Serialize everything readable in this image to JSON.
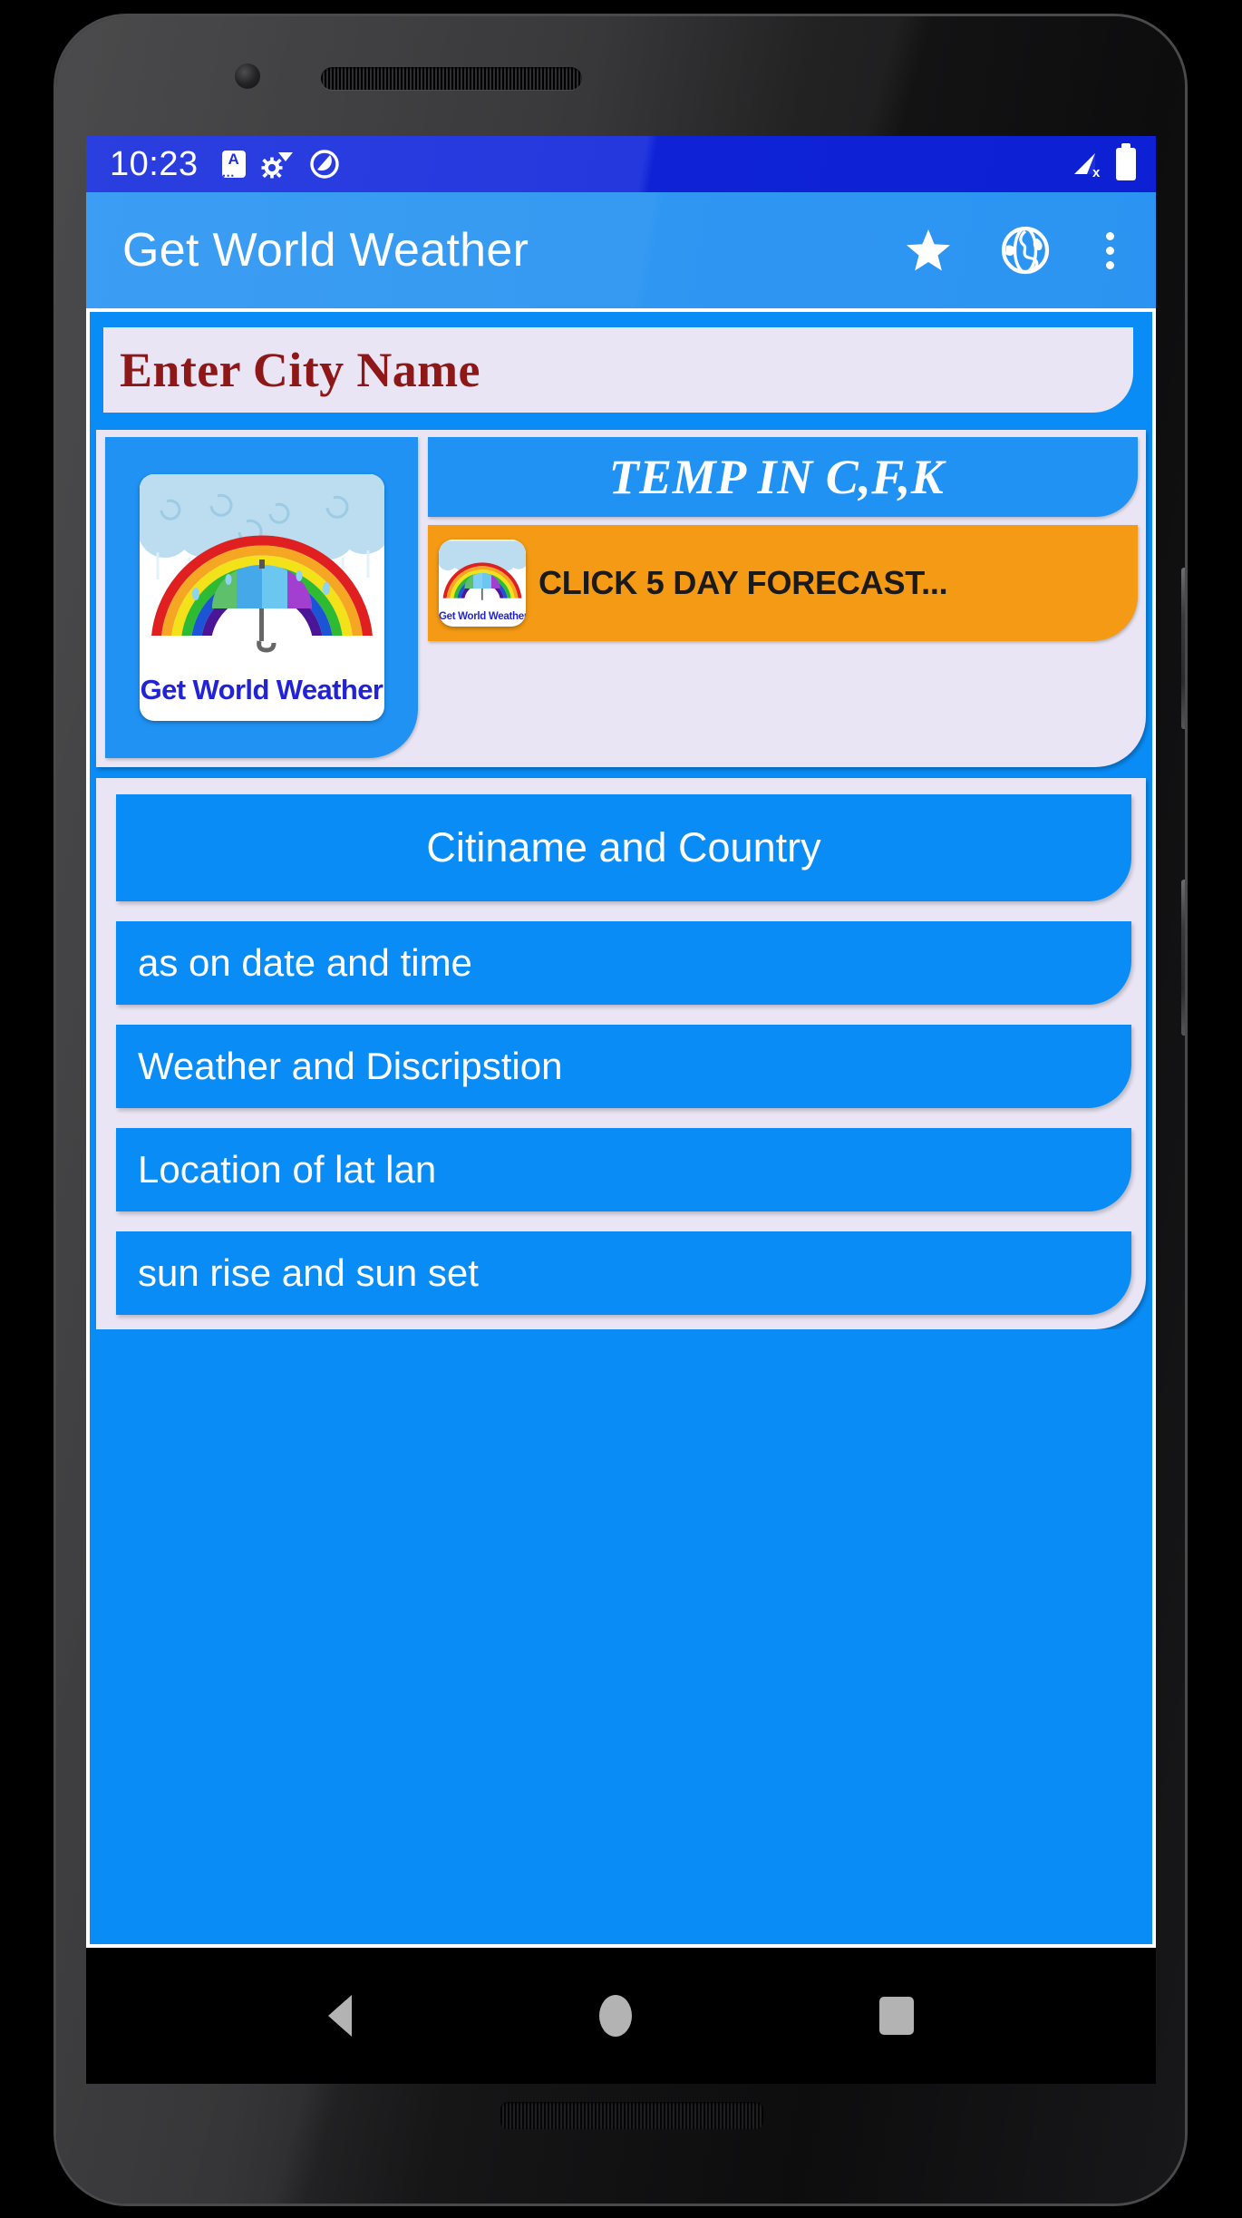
{
  "status_bar": {
    "clock": "10:23",
    "icons_left": [
      "keyboard-a-icon",
      "settings-wifi-icon",
      "do-not-disturb-icon"
    ],
    "icons_right": [
      "signal-no-sim-icon",
      "battery-full-icon"
    ],
    "background": "#1f31d8"
  },
  "app_bar": {
    "title": "Get World Weather",
    "background": "#369af2",
    "actions": [
      {
        "name": "favorite-star-icon",
        "glyph": "star"
      },
      {
        "name": "globe-icon",
        "glyph": "globe"
      },
      {
        "name": "overflow-menu-icon",
        "glyph": "dots"
      }
    ]
  },
  "search": {
    "placeholder": "Enter City Name",
    "value": "",
    "text_color": "#8e1717",
    "field_background": "#E9E5F4"
  },
  "hero": {
    "logo_caption": "Get World Weather",
    "temp_banner": "TEMP IN C,F,K",
    "temp_banner_background": "#1f92f4",
    "forecast_button": {
      "label": "CLICK 5 DAY FORECAST...",
      "background": "#F49A14",
      "text_color": "#1a1a1a",
      "thumb_caption": "Get World Weather"
    }
  },
  "info_rows": [
    {
      "label": "Citiname and Country",
      "align": "center"
    },
    {
      "label": "as on date and time",
      "align": "left"
    },
    {
      "label": "Weather and Discripstion",
      "align": "left"
    },
    {
      "label": "Location of lat lan",
      "align": "left"
    },
    {
      "label": "sun rise and sun set",
      "align": "left"
    }
  ],
  "colors": {
    "row_blue": "#0a8cf6",
    "card_lavender": "#E9E5F4",
    "accent_orange": "#F49A14",
    "app_bar_blue": "#369af2",
    "status_blue": "#1f31d8"
  },
  "nav_bar": {
    "buttons": [
      {
        "name": "nav-back-button",
        "glyph": "triangle-left"
      },
      {
        "name": "nav-home-button",
        "glyph": "circle"
      },
      {
        "name": "nav-recents-button",
        "glyph": "square"
      }
    ]
  }
}
